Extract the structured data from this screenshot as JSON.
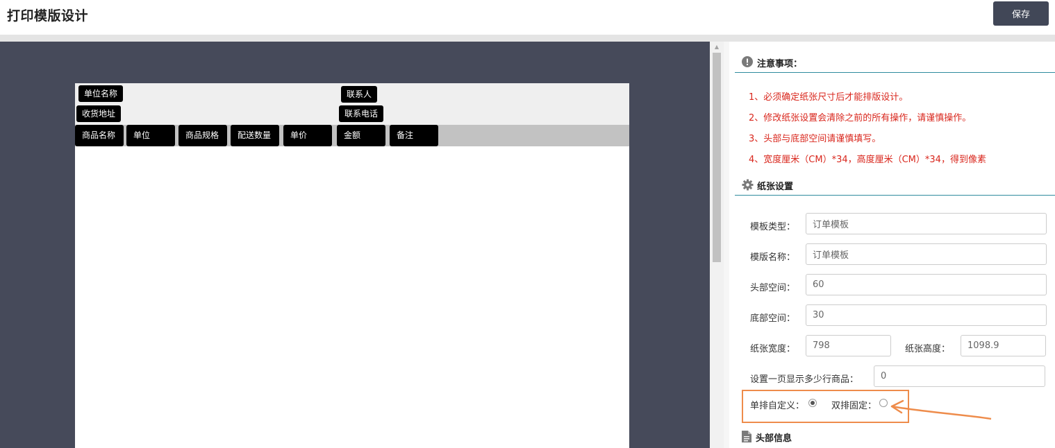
{
  "header": {
    "title": "打印模版设计",
    "save_label": "保存"
  },
  "canvas": {
    "header_fields": [
      "单位名称",
      "联系人",
      "收货地址",
      "联系电话"
    ],
    "columns": [
      "商品名称",
      "单位",
      "商品规格",
      "配送数量",
      "单价",
      "金额",
      "备注"
    ]
  },
  "notice": {
    "title": "注意事项：",
    "lines": [
      "1、必须确定纸张尺寸后才能排版设计。",
      "2、修改纸张设置会清除之前的所有操作，请谨慎操作。",
      "3、头部与底部空间请谨慎填写。",
      "4、宽度厘米（CM）*34，高度厘米（CM）*34，得到像素"
    ]
  },
  "paper_settings": {
    "title": "纸张设置",
    "template_type_label": "模板类型：",
    "template_type_value": "订单模板",
    "template_name_label": "模版名称：",
    "template_name_value": "订单模板",
    "header_space_label": "头部空间：",
    "header_space_value": "60",
    "footer_space_label": "底部空间：",
    "footer_space_value": "30",
    "paper_width_label": "纸张宽度：",
    "paper_width_value": "798",
    "paper_height_label": "纸张高度：",
    "paper_height_value": "1098.9",
    "rows_per_page_label": "设置一页显示多少行商品：",
    "rows_per_page_value": "0",
    "single_custom_label": "单排自定义：",
    "double_fixed_label": "双排固定：",
    "selected_layout": "single"
  },
  "header_info": {
    "title": "头部信息"
  },
  "colors": {
    "canvas_bg": "#464a5a",
    "notice_red": "#d9261c",
    "section_rule": "#2e8b9e",
    "annotation_orange": "#ee8c4b",
    "save_button": "#414757"
  }
}
